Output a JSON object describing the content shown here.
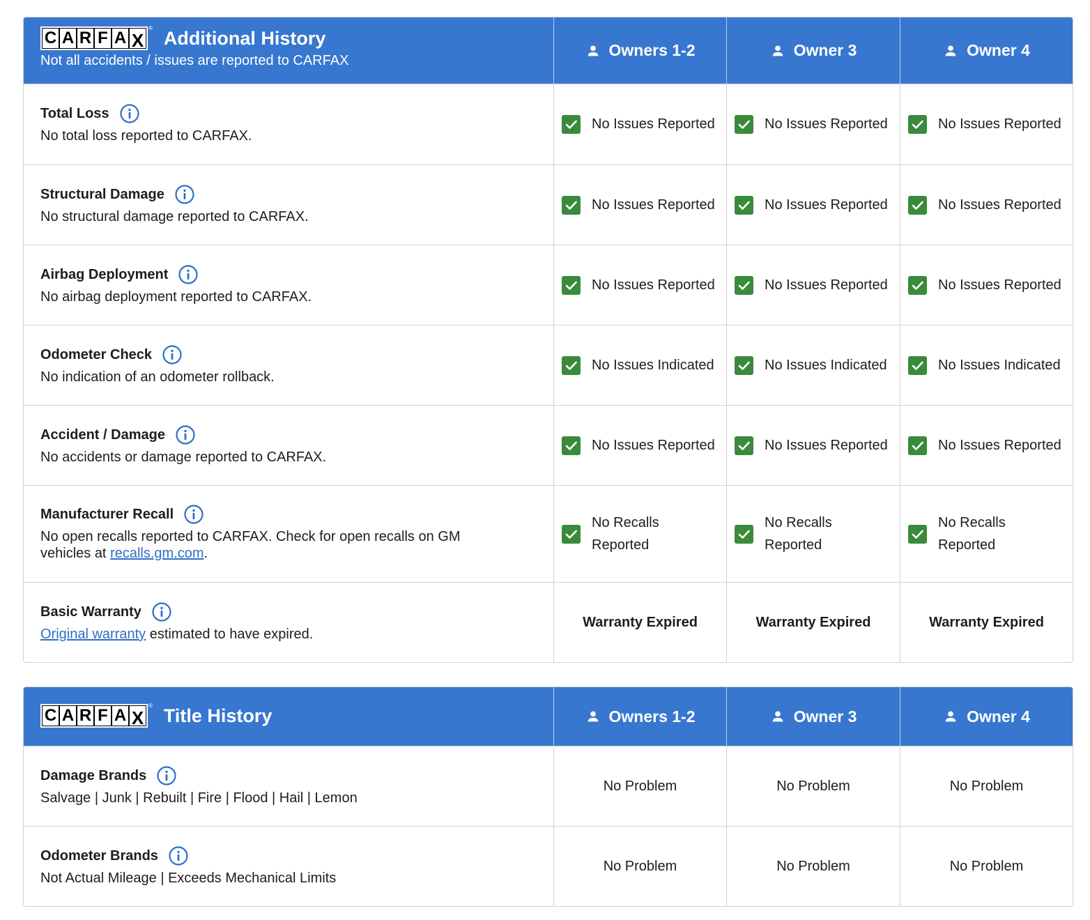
{
  "brand": {
    "logo_letters": [
      "C",
      "A",
      "R",
      "F",
      "A",
      "X"
    ],
    "reg_mark": "®"
  },
  "colors": {
    "header_bg": "#3777d0",
    "check_green": "#3a8a3c",
    "info_blue": "#2f6fc6",
    "link": "#2f6fc6"
  },
  "owners": [
    "Owners 1-2",
    "Owner 3",
    "Owner 4"
  ],
  "additional_history": {
    "title": "Additional History",
    "subtitle": "Not all accidents / issues are reported to CARFAX",
    "rows": [
      {
        "label": "Total Loss",
        "description": "No total loss reported to CARFAX.",
        "values": [
          "No Issues Reported",
          "No Issues Reported",
          "No Issues Reported"
        ]
      },
      {
        "label": "Structural Damage",
        "description": "No structural damage reported to CARFAX.",
        "values": [
          "No Issues Reported",
          "No Issues Reported",
          "No Issues Reported"
        ]
      },
      {
        "label": "Airbag Deployment",
        "description": "No airbag deployment reported to CARFAX.",
        "values": [
          "No Issues Reported",
          "No Issues Reported",
          "No Issues Reported"
        ]
      },
      {
        "label": "Odometer Check",
        "description": "No indication of an odometer rollback.",
        "values": [
          "No Issues Indicated",
          "No Issues Indicated",
          "No Issues Indicated"
        ]
      },
      {
        "label": "Accident / Damage",
        "description": "No accidents or damage reported to CARFAX.",
        "values": [
          "No Issues Reported",
          "No Issues Reported",
          "No Issues Reported"
        ]
      },
      {
        "label": "Manufacturer Recall",
        "description_prefix": "No open recalls reported to CARFAX. Check for open recalls on GM vehicles at ",
        "link_text": "recalls.gm.com",
        "description_suffix": ".",
        "values_line1": [
          "No Recalls",
          "No Recalls",
          "No Recalls"
        ],
        "values_line2": [
          "Reported",
          "Reported",
          "Reported"
        ]
      },
      {
        "label": "Basic Warranty",
        "link_text": "Original warranty",
        "description_suffix": " estimated to have expired.",
        "values": [
          "Warranty Expired",
          "Warranty Expired",
          "Warranty Expired"
        ]
      }
    ]
  },
  "title_history": {
    "title": "Title History",
    "rows": [
      {
        "label": "Damage Brands",
        "description": "Salvage | Junk | Rebuilt | Fire | Flood | Hail | Lemon",
        "values": [
          "No Problem",
          "No Problem",
          "No Problem"
        ]
      },
      {
        "label": "Odometer Brands",
        "description": "Not Actual Mileage | Exceeds Mechanical Limits",
        "values": [
          "No Problem",
          "No Problem",
          "No Problem"
        ]
      }
    ]
  }
}
